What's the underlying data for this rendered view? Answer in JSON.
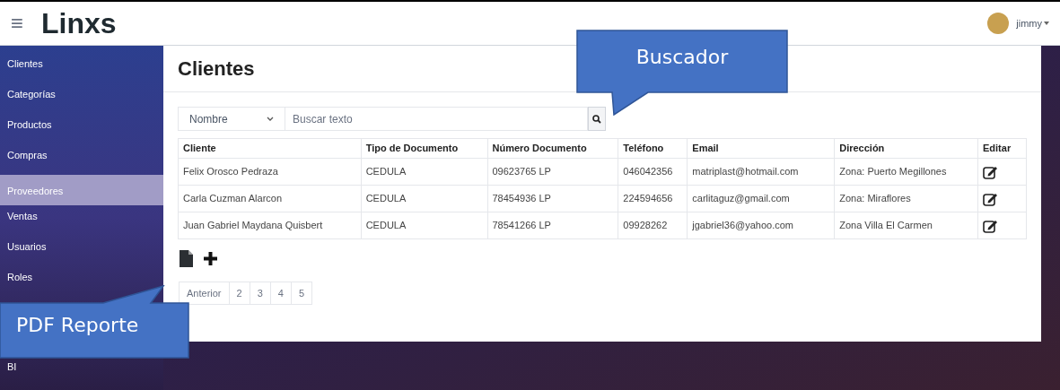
{
  "header": {
    "logo": "Linxs",
    "menu_icon": "≡",
    "user": "jimmy"
  },
  "sidebar": {
    "items": [
      {
        "label": "Clientes",
        "selected": false
      },
      {
        "label": "Categorías",
        "selected": false
      },
      {
        "label": "Productos",
        "selected": false
      },
      {
        "label": "Compras",
        "selected": false
      },
      {
        "label": "Proveedores",
        "selected": true
      },
      {
        "label": "Ventas",
        "selected": false
      },
      {
        "label": "Usuarios",
        "selected": false
      },
      {
        "label": "Roles",
        "selected": false
      },
      {
        "label": "BI",
        "selected": false
      }
    ]
  },
  "page": {
    "title": "Clientes"
  },
  "search": {
    "filter": "Nombre",
    "placeholder": "Buscar texto"
  },
  "table": {
    "columns": [
      "Cliente",
      "Tipo de Documento",
      "Número Documento",
      "Teléfono",
      "Email",
      "Dirección",
      "Editar"
    ],
    "rows": [
      [
        "Felix Orosco Pedraza",
        "CEDULA",
        "09623765 LP",
        "046042356",
        "matriplast@hotmail.com",
        "Zona: Puerto Megillones"
      ],
      [
        "Carla Cuzman Alarcon",
        "CEDULA",
        "78454936 LP",
        "224594656",
        "carlitaguz@gmail.com",
        "Zona: Miraflores"
      ],
      [
        "Juan Gabriel Maydana Quisbert",
        "CEDULA",
        "78541266 LP",
        "09928262",
        "jgabriel36@yahoo.com",
        "Zona Villa El Carmen"
      ]
    ]
  },
  "pagination": [
    "Anterior",
    "2",
    "3",
    "4",
    "5"
  ],
  "callouts": [
    {
      "text": "Buscador",
      "kind": "down"
    },
    {
      "text": "PDF Reporte",
      "kind": "up"
    }
  ]
}
